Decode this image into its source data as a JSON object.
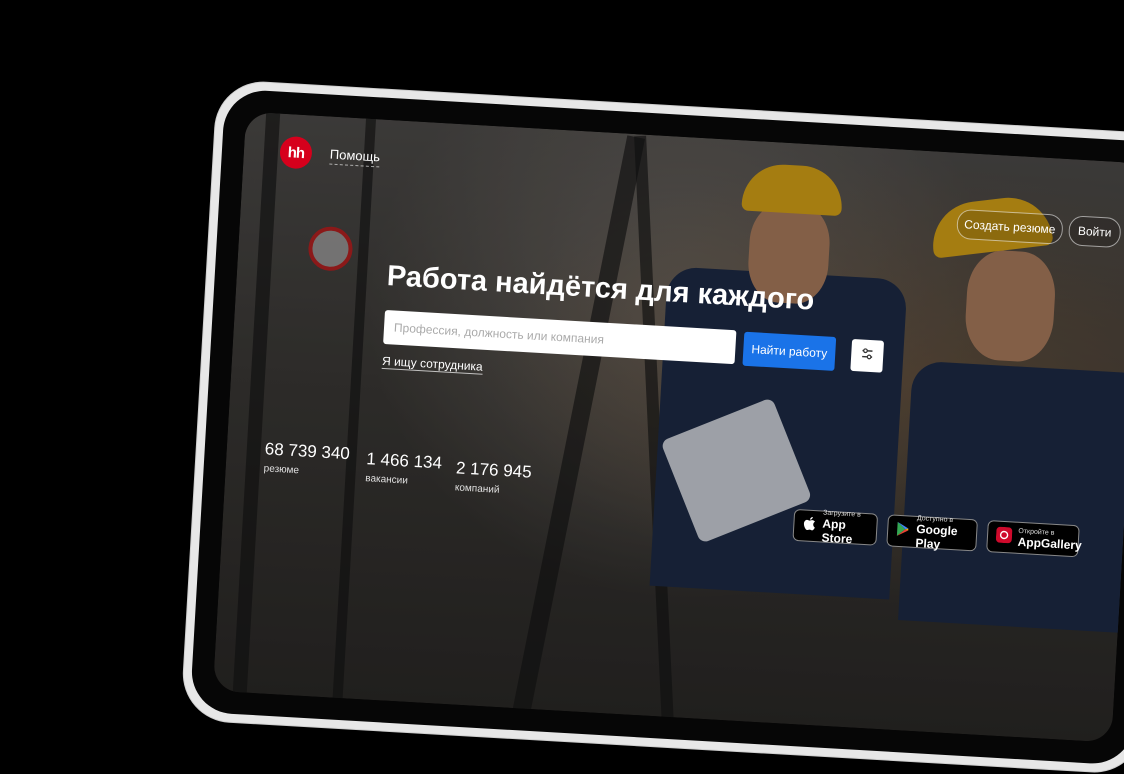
{
  "header": {
    "logo_text": "hh",
    "help_label": "Помощь",
    "create_resume_label": "Создать резюме",
    "login_label": "Войти"
  },
  "hero": {
    "headline": "Работа найдётся для каждого",
    "search": {
      "placeholder": "Профессия, должность или компания",
      "value": ""
    },
    "find_button_label": "Найти работу",
    "advanced_search_icon": "sliders-icon",
    "employer_link_label": "Я ищу сотрудника"
  },
  "stats": [
    {
      "value": "68 739 340",
      "label": "резюме"
    },
    {
      "value": "1 466 134",
      "label": "вакансии"
    },
    {
      "value": "2 176 945",
      "label": "компаний"
    }
  ],
  "stores": [
    {
      "small": "Загрузите в",
      "name": "App Store",
      "icon": "apple-icon"
    },
    {
      "small": "Доступно в",
      "name": "Google Play",
      "icon": "google-play-icon"
    },
    {
      "small": "Откройте в",
      "name": "AppGallery",
      "icon": "huawei-icon"
    }
  ],
  "colors": {
    "brand_red": "#d6001c",
    "primary_button": "#1a73e8",
    "background": "#000000"
  }
}
